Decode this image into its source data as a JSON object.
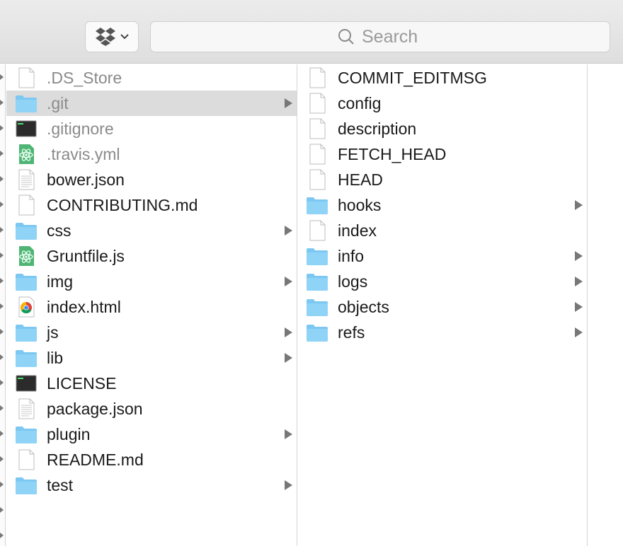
{
  "toolbar": {
    "dropbox_icon": "dropbox-icon",
    "search_placeholder": "Search"
  },
  "column1": [
    {
      "label": ".DS_Store",
      "icon": "document-icon",
      "dim": true,
      "folder": false
    },
    {
      "label": ".git",
      "icon": "folder-icon",
      "dim": true,
      "folder": true,
      "selected": true
    },
    {
      "label": ".gitignore",
      "icon": "terminal-icon",
      "dim": true,
      "folder": false
    },
    {
      "label": ".travis.yml",
      "icon": "atom-icon",
      "dim": true,
      "folder": false
    },
    {
      "label": "bower.json",
      "icon": "text-document-icon",
      "dim": false,
      "folder": false
    },
    {
      "label": "CONTRIBUTING.md",
      "icon": "document-icon",
      "dim": false,
      "folder": false
    },
    {
      "label": "css",
      "icon": "folder-icon",
      "dim": false,
      "folder": true
    },
    {
      "label": "Gruntfile.js",
      "icon": "atom-icon",
      "dim": false,
      "folder": false
    },
    {
      "label": "img",
      "icon": "folder-icon",
      "dim": false,
      "folder": true
    },
    {
      "label": "index.html",
      "icon": "chrome-icon",
      "dim": false,
      "folder": false
    },
    {
      "label": "js",
      "icon": "folder-icon",
      "dim": false,
      "folder": true
    },
    {
      "label": "lib",
      "icon": "folder-icon",
      "dim": false,
      "folder": true
    },
    {
      "label": "LICENSE",
      "icon": "terminal-icon",
      "dim": false,
      "folder": false
    },
    {
      "label": "package.json",
      "icon": "text-document-icon",
      "dim": false,
      "folder": false
    },
    {
      "label": "plugin",
      "icon": "folder-icon",
      "dim": false,
      "folder": true
    },
    {
      "label": "README.md",
      "icon": "document-icon",
      "dim": false,
      "folder": false
    },
    {
      "label": "test",
      "icon": "folder-icon",
      "dim": false,
      "folder": true
    }
  ],
  "column2": [
    {
      "label": "COMMIT_EDITMSG",
      "icon": "document-icon",
      "folder": false
    },
    {
      "label": "config",
      "icon": "document-icon",
      "folder": false
    },
    {
      "label": "description",
      "icon": "document-icon",
      "folder": false
    },
    {
      "label": "FETCH_HEAD",
      "icon": "document-icon",
      "folder": false
    },
    {
      "label": "HEAD",
      "icon": "document-icon",
      "folder": false
    },
    {
      "label": "hooks",
      "icon": "folder-icon",
      "folder": true
    },
    {
      "label": "index",
      "icon": "document-icon",
      "folder": false
    },
    {
      "label": "info",
      "icon": "folder-icon",
      "folder": true
    },
    {
      "label": "logs",
      "icon": "folder-icon",
      "folder": true
    },
    {
      "label": "objects",
      "icon": "folder-icon",
      "folder": true
    },
    {
      "label": "refs",
      "icon": "folder-icon",
      "folder": true
    }
  ],
  "colors": {
    "folder": "#7cc8f2",
    "selection": "#dcdcdc",
    "dim_text": "#8a8a8a"
  }
}
